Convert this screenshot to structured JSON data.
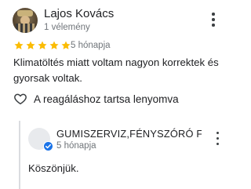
{
  "review": {
    "author_name": "Lajos Kovács",
    "author_reviews": "1 vélemény",
    "rating": 5,
    "rating_max": 5,
    "time": "5 hónapja",
    "text": "Klimatöltés miatt voltam nagyon korrektek és gyorsak voltak.",
    "like_label": "A reagáláshoz tartsa lenyomva",
    "icons": {
      "more": "more-vert-icon",
      "like": "heart-outline-icon",
      "star": "star-icon"
    }
  },
  "reply": {
    "author_name": "GUMISZERVIZ,FÉNYSZÓRÓ FEL...",
    "time": "5 hónapja",
    "text": "Köszönjük.",
    "icons": {
      "more": "more-vert-icon",
      "verified": "verified-check-icon"
    }
  },
  "colors": {
    "star": "#fbbc04",
    "verified": "#1a73e8",
    "secondary_text": "#70757a"
  }
}
